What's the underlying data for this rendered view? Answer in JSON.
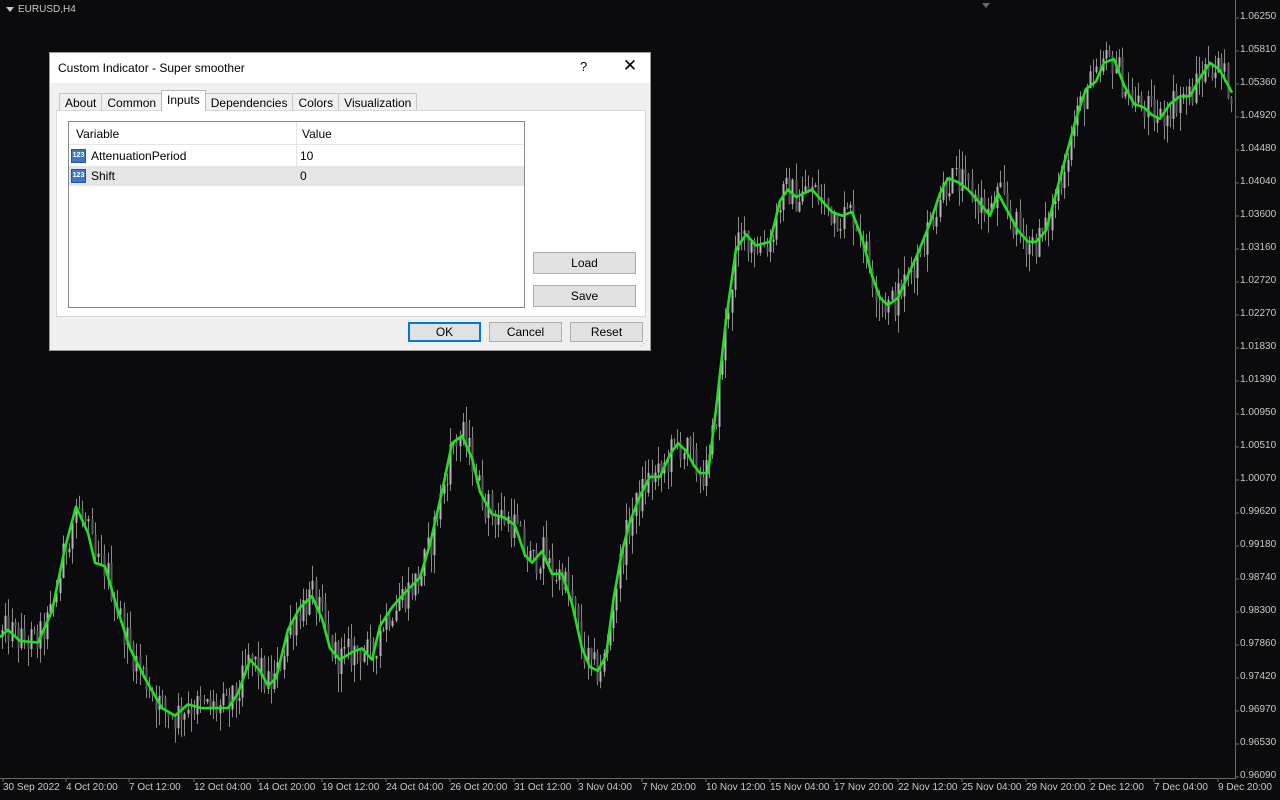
{
  "chart": {
    "symbol": "EURUSD,H4",
    "background": "#0b0b0e",
    "candle_color": "#8a8a8a",
    "line_color": "#22e022",
    "y_ticks": [
      "1.06250",
      "1.05810",
      "1.05360",
      "1.04920",
      "1.04480",
      "1.04040",
      "1.03600",
      "1.03160",
      "1.02720",
      "1.02270",
      "1.01830",
      "1.01390",
      "1.00950",
      "1.00510",
      "1.00070",
      "0.99620",
      "0.99180",
      "0.98740",
      "0.98300",
      "0.97860",
      "0.97420",
      "0.96970",
      "0.96530",
      "0.96090"
    ],
    "x_ticks": [
      "30 Sep 2022",
      "4 Oct 20:00",
      "7 Oct 12:00",
      "12 Oct 04:00",
      "14 Oct 20:00",
      "19 Oct 12:00",
      "24 Oct 04:00",
      "26 Oct 20:00",
      "31 Oct 12:00",
      "3 Nov 04:00",
      "7 Nov 20:00",
      "10 Nov 12:00",
      "15 Nov 04:00",
      "17 Nov 20:00",
      "22 Nov 12:00",
      "25 Nov 04:00",
      "29 Nov 20:00",
      "2 Dec 12:00",
      "7 Dec 04:00",
      "9 Dec 20:00"
    ],
    "y_max": 1.0625,
    "y_min": 0.9609,
    "smoother_points": [
      [
        0,
        0.9795
      ],
      [
        8,
        0.9805
      ],
      [
        20,
        0.979
      ],
      [
        38,
        0.9788
      ],
      [
        52,
        0.983
      ],
      [
        65,
        0.9915
      ],
      [
        76,
        0.997
      ],
      [
        88,
        0.9935
      ],
      [
        95,
        0.9895
      ],
      [
        105,
        0.989
      ],
      [
        118,
        0.983
      ],
      [
        130,
        0.978
      ],
      [
        145,
        0.974
      ],
      [
        162,
        0.97
      ],
      [
        175,
        0.969
      ],
      [
        188,
        0.9705
      ],
      [
        202,
        0.97
      ],
      [
        215,
        0.97
      ],
      [
        228,
        0.97
      ],
      [
        238,
        0.972
      ],
      [
        250,
        0.9765
      ],
      [
        260,
        0.975
      ],
      [
        268,
        0.973
      ],
      [
        276,
        0.974
      ],
      [
        288,
        0.9805
      ],
      [
        300,
        0.9835
      ],
      [
        312,
        0.985
      ],
      [
        322,
        0.982
      ],
      [
        330,
        0.978
      ],
      [
        340,
        0.9765
      ],
      [
        352,
        0.9775
      ],
      [
        362,
        0.978
      ],
      [
        372,
        0.9765
      ],
      [
        380,
        0.981
      ],
      [
        392,
        0.9835
      ],
      [
        405,
        0.9855
      ],
      [
        420,
        0.9875
      ],
      [
        430,
        0.992
      ],
      [
        442,
        0.999
      ],
      [
        452,
        1.0055
      ],
      [
        462,
        1.0065
      ],
      [
        472,
        1.0035
      ],
      [
        480,
        0.999
      ],
      [
        492,
        0.996
      ],
      [
        505,
        0.9955
      ],
      [
        515,
        0.9945
      ],
      [
        525,
        0.9905
      ],
      [
        532,
        0.9895
      ],
      [
        542,
        0.991
      ],
      [
        552,
        0.988
      ],
      [
        562,
        0.988
      ],
      [
        572,
        0.984
      ],
      [
        582,
        0.978
      ],
      [
        590,
        0.9755
      ],
      [
        598,
        0.975
      ],
      [
        606,
        0.977
      ],
      [
        614,
        0.985
      ],
      [
        622,
        0.991
      ],
      [
        630,
        0.995
      ],
      [
        640,
        0.9985
      ],
      [
        650,
        1.001
      ],
      [
        660,
        1.001
      ],
      [
        670,
        1.004
      ],
      [
        678,
        1.0055
      ],
      [
        686,
        1.0045
      ],
      [
        694,
        1.0025
      ],
      [
        700,
        1.0015
      ],
      [
        708,
        1.0015
      ],
      [
        716,
        1.01
      ],
      [
        726,
        1.022
      ],
      [
        736,
        1.0315
      ],
      [
        746,
        1.0335
      ],
      [
        756,
        1.032
      ],
      [
        770,
        1.0325
      ],
      [
        780,
        1.038
      ],
      [
        788,
        1.0395
      ],
      [
        796,
        1.0385
      ],
      [
        804,
        1.039
      ],
      [
        812,
        1.0395
      ],
      [
        822,
        1.038
      ],
      [
        832,
        1.0365
      ],
      [
        842,
        1.036
      ],
      [
        852,
        1.0365
      ],
      [
        862,
        1.033
      ],
      [
        872,
        1.028
      ],
      [
        880,
        1.025
      ],
      [
        888,
        1.024
      ],
      [
        898,
        1.025
      ],
      [
        908,
        1.028
      ],
      [
        918,
        1.031
      ],
      [
        930,
        1.035
      ],
      [
        940,
        1.039
      ],
      [
        948,
        1.041
      ],
      [
        958,
        1.0405
      ],
      [
        968,
        1.0395
      ],
      [
        978,
        1.038
      ],
      [
        990,
        1.036
      ],
      [
        998,
        1.039
      ],
      [
        1008,
        1.0365
      ],
      [
        1018,
        1.034
      ],
      [
        1028,
        1.0325
      ],
      [
        1036,
        1.0325
      ],
      [
        1046,
        1.034
      ],
      [
        1056,
        1.039
      ],
      [
        1066,
        1.044
      ],
      [
        1076,
        1.049
      ],
      [
        1086,
        1.053
      ],
      [
        1096,
        1.054
      ],
      [
        1104,
        1.0565
      ],
      [
        1114,
        1.057
      ],
      [
        1124,
        1.0535
      ],
      [
        1134,
        1.051
      ],
      [
        1144,
        1.0505
      ],
      [
        1152,
        1.0495
      ],
      [
        1160,
        1.049
      ],
      [
        1170,
        1.051
      ],
      [
        1180,
        1.052
      ],
      [
        1190,
        1.052
      ],
      [
        1200,
        1.0545
      ],
      [
        1210,
        1.0565
      ],
      [
        1220,
        1.0555
      ],
      [
        1232,
        1.0525
      ]
    ]
  },
  "dialog": {
    "title": "Custom Indicator - Super smoother",
    "help_label": "?",
    "close_label": "✕",
    "tabs": [
      "About",
      "Common",
      "Inputs",
      "Dependencies",
      "Colors",
      "Visualization"
    ],
    "active_tab": "Inputs",
    "grid": {
      "col_variable": "Variable",
      "col_value": "Value",
      "rows": [
        {
          "icon": "123",
          "name": "AttenuationPeriod",
          "value": "10"
        },
        {
          "icon": "123",
          "name": "Shift",
          "value": "0"
        }
      ]
    },
    "load_label": "Load",
    "save_label": "Save",
    "ok_label": "OK",
    "cancel_label": "Cancel",
    "reset_label": "Reset"
  }
}
